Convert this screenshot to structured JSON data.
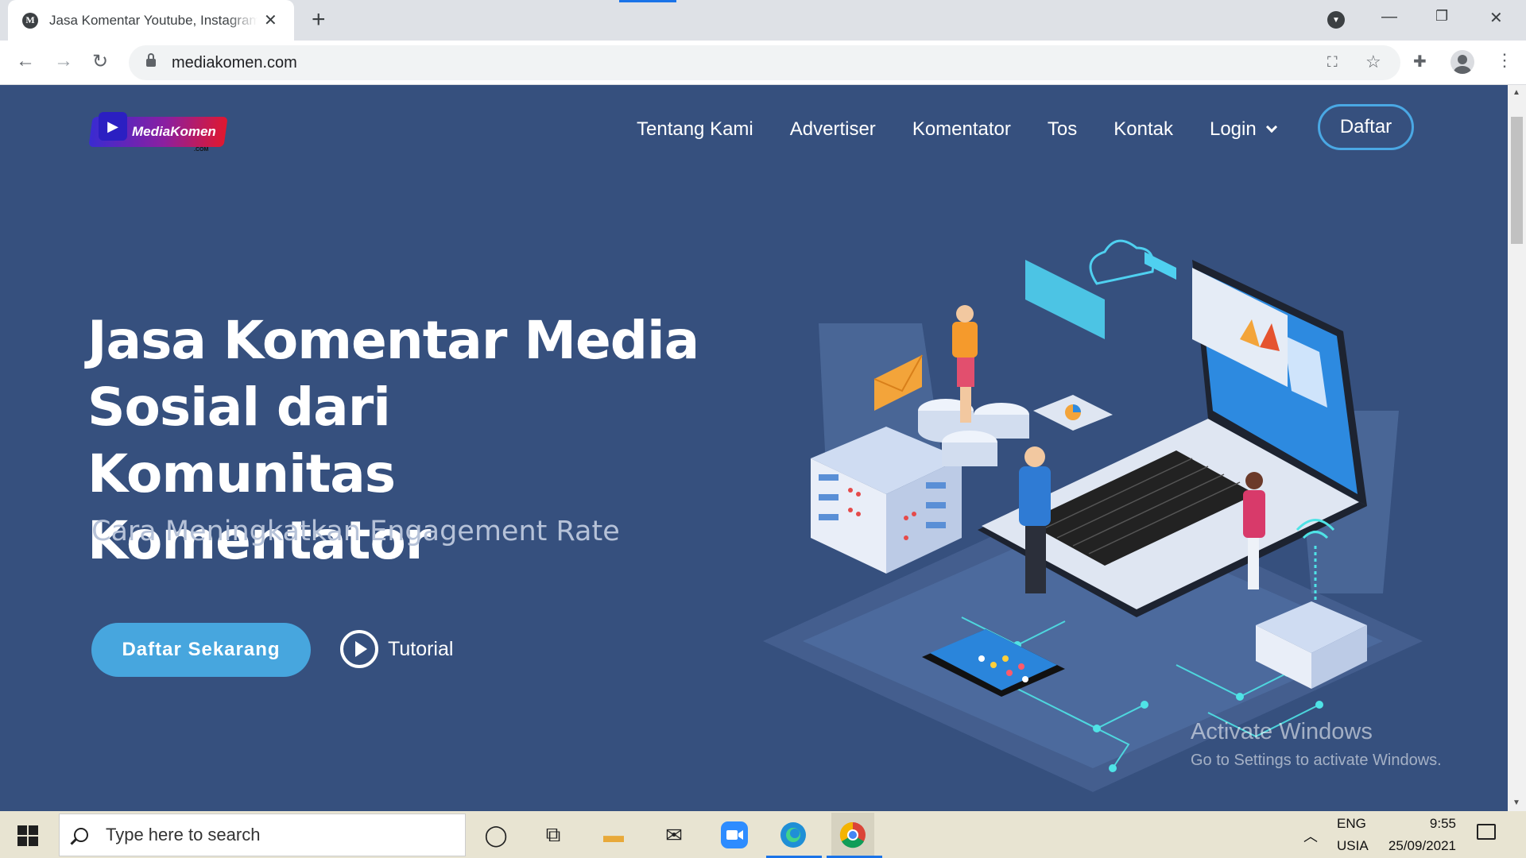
{
  "browser": {
    "tab_title": "Jasa Komentar Youtube, Instagram",
    "tab_favicon": "M",
    "new_tab": "+",
    "url": "mediakomen.com",
    "icons": [
      "back-arrow-icon",
      "forward-arrow-icon",
      "reload-icon",
      "lock-icon",
      "translate-icon",
      "star-icon",
      "extensions-icon",
      "profile-icon",
      "menu-icon"
    ]
  },
  "site": {
    "logo_text": "MediaKomen",
    "logo_sub": ".COM",
    "nav": {
      "items": [
        "Tentang Kami",
        "Advertiser",
        "Komentator",
        "Tos",
        "Kontak"
      ],
      "login": "Login",
      "daftar": "Daftar"
    },
    "hero": {
      "title": "Jasa Komentar Media Sosial dari Komunitas Komentator",
      "subtitle": "Cara Meningkatkan Engagement Rate",
      "cta": "Daftar Sekarang",
      "tutorial": "Tutorial"
    },
    "background_color": "#36507e",
    "accent_color": "#47a6de"
  },
  "watermark": {
    "title": "Activate Windows",
    "subtitle": "Go to Settings to activate Windows."
  },
  "taskbar": {
    "search_placeholder": "Type here to search",
    "lang_top": "ENG",
    "lang_bottom": "USIA",
    "time": "9:55",
    "date": "25/09/2021",
    "apps": [
      "cortana-icon",
      "task-view-icon",
      "file-explorer-icon",
      "mail-icon",
      "zoom-icon",
      "edge-icon",
      "chrome-icon"
    ]
  }
}
